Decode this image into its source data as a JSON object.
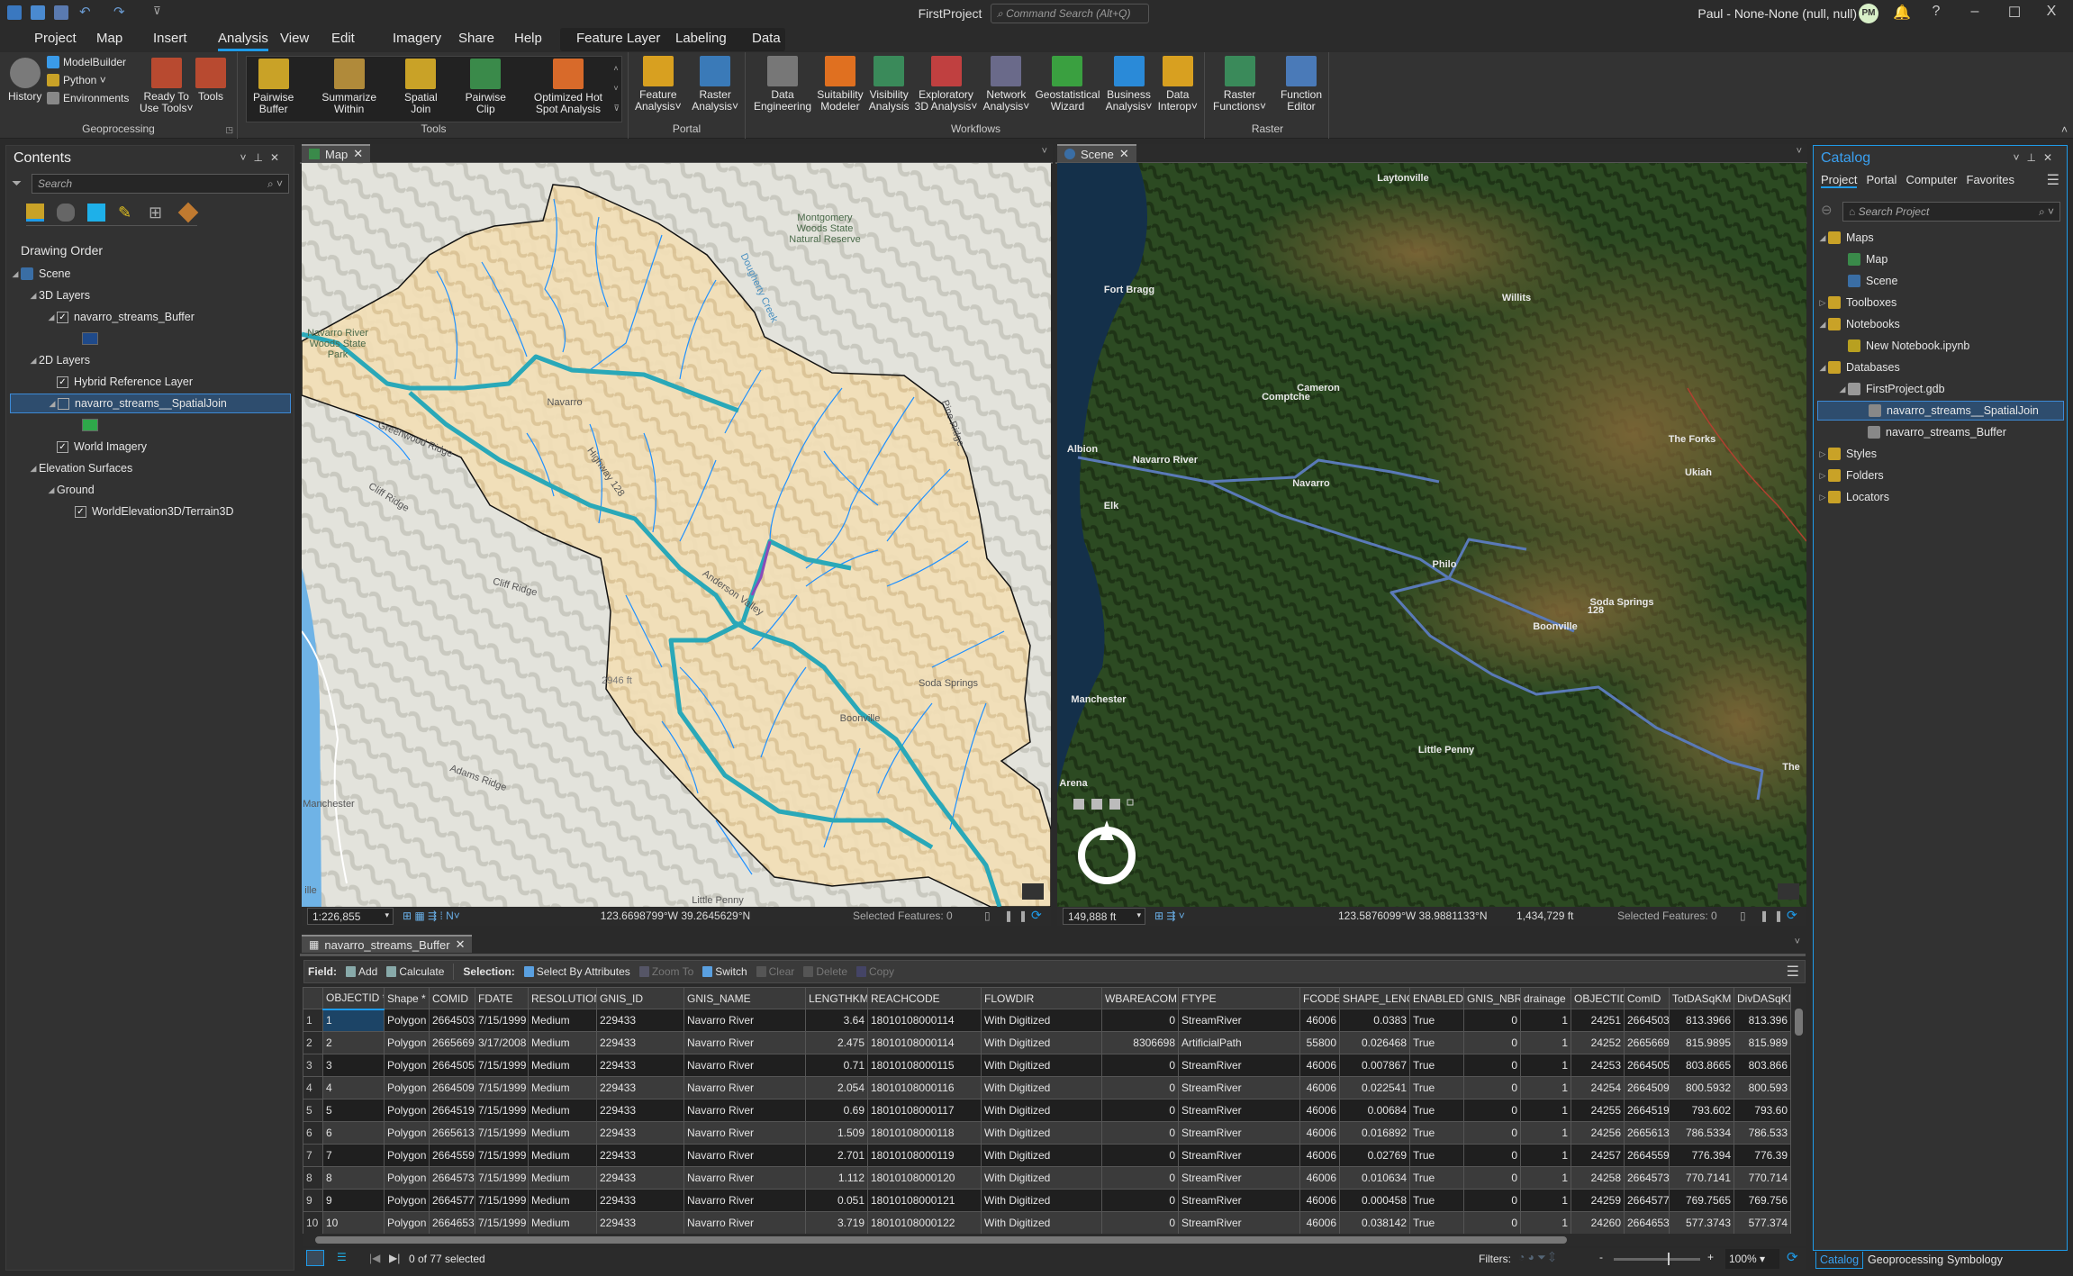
{
  "app": {
    "title": "FirstProject",
    "command_search_placeholder": "Command Search (Alt+Q)",
    "user": "Paul - None-None (null, null)",
    "avatar_initials": "PM",
    "help": "?",
    "minimize": "–",
    "maximize": "☐",
    "close": "X"
  },
  "tabs": [
    "Project",
    "Map",
    "Insert",
    "Analysis",
    "View",
    "Edit",
    "Imagery",
    "Share",
    "Help"
  ],
  "active_tab": "Analysis",
  "contextual_tabs": [
    "Feature Layer",
    "Labeling",
    "Data"
  ],
  "ribbon": {
    "geoprocessing": {
      "label": "Geoprocessing",
      "history": "History",
      "small": [
        "ModelBuilder",
        "Python ˅",
        "Environments"
      ],
      "ready": "Ready To\nUse Tools˅",
      "tools": "Tools"
    },
    "tools": {
      "label": "Tools",
      "buttons": [
        {
          "label": "Pairwise\nBuffer",
          "icon": "pairwise-buffer-icon",
          "color": "#c9a227"
        },
        {
          "label": "Summarize\nWithin",
          "icon": "summarize-within-icon",
          "color": "#b08a3a"
        },
        {
          "label": "Spatial\nJoin",
          "icon": "spatial-join-icon",
          "color": "#c9a227"
        },
        {
          "label": "Pairwise\nClip",
          "icon": "pairwise-clip-icon",
          "color": "#3a8a4a"
        },
        {
          "label": "Optimized Hot\nSpot Analysis",
          "icon": "hot-spot-icon",
          "color": "#d86a2a"
        }
      ]
    },
    "portal": {
      "label": "Portal",
      "buttons": [
        {
          "label": "Feature\nAnalysis˅",
          "icon": "feature-analysis-icon",
          "color": "#d8a020"
        },
        {
          "label": "Raster\nAnalysis˅",
          "icon": "raster-analysis-icon",
          "color": "#3a7ab8"
        }
      ]
    },
    "workflows": {
      "label": "Workflows",
      "buttons": [
        {
          "label": "Data\nEngineering",
          "icon": "data-engineering-icon",
          "color": "#777777"
        },
        {
          "label": "Suitability\nModeler",
          "icon": "suitability-modeler-icon",
          "color": "#e07020"
        },
        {
          "label": "Visibility\nAnalysis",
          "icon": "visibility-analysis-icon",
          "color": "#3a8a5a"
        },
        {
          "label": "Exploratory\n3D Analysis˅",
          "icon": "exploratory-3d-icon",
          "color": "#c04040"
        },
        {
          "label": "Network\nAnalysis˅",
          "icon": "network-analysis-icon",
          "color": "#6a6a8a"
        },
        {
          "label": "Geostatistical\nWizard",
          "icon": "geostatistical-wizard-icon",
          "color": "#3aa040"
        },
        {
          "label": "Business\nAnalysis˅",
          "icon": "business-analysis-icon",
          "color": "#2a8ad8"
        },
        {
          "label": "Data\nInterop˅",
          "icon": "data-interop-icon",
          "color": "#d8a020"
        }
      ]
    },
    "raster": {
      "label": "Raster",
      "buttons": [
        {
          "label": "Raster\nFunctions˅",
          "icon": "raster-functions-icon",
          "color": "#3a8a5a"
        },
        {
          "label": "Function\nEditor",
          "icon": "function-editor-icon",
          "color": "#4a7ab8"
        }
      ]
    }
  },
  "contents": {
    "title": "Contents",
    "search_placeholder": "Search",
    "section": "Drawing Order",
    "items": [
      {
        "label": "Scene",
        "depth": 0,
        "exp": "◢",
        "icon": "globe-icon",
        "color": "#3a6ea5"
      },
      {
        "label": "3D Layers",
        "depth": 1,
        "exp": "◢"
      },
      {
        "label": "navarro_streams_Buffer",
        "depth": 2,
        "exp": "◢",
        "check": true
      },
      {
        "swatch": "#1f4a8a",
        "depth": 2
      },
      {
        "label": "2D Layers",
        "depth": 1,
        "exp": "◢"
      },
      {
        "label": "Hybrid Reference Layer",
        "depth": 2,
        "check": true
      },
      {
        "label": "navarro_streams__SpatialJoin",
        "depth": 2,
        "exp": "◢",
        "check": false,
        "selected": true
      },
      {
        "swatch": "#2ea84a",
        "depth": 2
      },
      {
        "label": "World Imagery",
        "depth": 2,
        "check": true
      },
      {
        "label": "Elevation Surfaces",
        "depth": 1,
        "exp": "◢"
      },
      {
        "label": "Ground",
        "depth": 2,
        "exp": "◢"
      },
      {
        "label": "WorldElevation3D/Terrain3D",
        "depth": 3,
        "check": true
      }
    ]
  },
  "map_view": {
    "tab": "Map",
    "labels": [
      "Montgomery",
      "Woods State",
      "Natural Reserve",
      "Navarro River",
      "Woods State",
      "Park",
      "Navarro",
      "Cliff Ridge",
      "Cliff Ridge",
      "Adams Ridge",
      "Manchester",
      "Little Penny",
      "Soda Springs",
      "Boonville",
      "Anderson Valley",
      "Dougherty Creek",
      "Pine Ridge",
      "Greenwood Ridge",
      "Highway 128",
      "2946 ft",
      "ille"
    ],
    "scale": "1:226,855",
    "coordinates": "123.6698799°W 39.2645629°N",
    "selected_features": "Selected Features: 0"
  },
  "scene_view": {
    "tab": "Scene",
    "labels": [
      "Laytonville",
      "Fort Bragg",
      "Willits",
      "Navarro River",
      "Navarro",
      "Philo",
      "Soda Springs",
      "Boonville",
      "Manchester",
      "Little Penny",
      "The",
      "Ukiah",
      "The Forks",
      "Albion",
      "Elk",
      "Comptche",
      "Cameron",
      "Arena",
      "128"
    ],
    "scale": "149,888 ft",
    "coordinates": "123.5876099°W 38.9881133°N",
    "elevation": "1,434,729 ft",
    "selected_features": "Selected Features: 0"
  },
  "catalog": {
    "title": "Catalog",
    "tabs": [
      "Project",
      "Portal",
      "Computer",
      "Favorites"
    ],
    "active_tab": "Project",
    "search_placeholder": "Search Project",
    "items": [
      {
        "label": "Maps",
        "depth": 0,
        "exp": "◢",
        "color": "#c9a227"
      },
      {
        "label": "Map",
        "depth": 1,
        "color": "#3a8a4a"
      },
      {
        "label": "Scene",
        "depth": 1,
        "color": "#3a6ea5"
      },
      {
        "label": "Toolboxes",
        "depth": 0,
        "exp": "▷",
        "color": "#c9a227"
      },
      {
        "label": "Notebooks",
        "depth": 0,
        "exp": "◢",
        "color": "#c9a227"
      },
      {
        "label": "New Notebook.ipynb",
        "depth": 1,
        "color": "#b8a020"
      },
      {
        "label": "Databases",
        "depth": 0,
        "exp": "◢",
        "color": "#c9a227"
      },
      {
        "label": "FirstProject.gdb",
        "depth": 1,
        "exp": "◢",
        "color": "#999999"
      },
      {
        "label": "navarro_streams__SpatialJoin",
        "depth": 2,
        "color": "#888888",
        "selected": true
      },
      {
        "label": "navarro_streams_Buffer",
        "depth": 2,
        "color": "#888888"
      },
      {
        "label": "Styles",
        "depth": 0,
        "exp": "▷",
        "color": "#c9a227"
      },
      {
        "label": "Folders",
        "depth": 0,
        "exp": "▷",
        "color": "#c9a227"
      },
      {
        "label": "Locators",
        "depth": 0,
        "exp": "▷",
        "color": "#c9a227"
      }
    ],
    "bottom_tabs": [
      "Catalog",
      "Geoprocessing",
      "Symbology"
    ]
  },
  "table": {
    "tab": "navarro_streams_Buffer",
    "toolbar": {
      "field": "Field:",
      "add": "Add",
      "calculate": "Calculate",
      "selection": "Selection:",
      "select_by_attributes": "Select By Attributes",
      "zoom_to": "Zoom To",
      "switch": "Switch",
      "clear": "Clear",
      "delete": "Delete",
      "copy": "Copy"
    },
    "columns": [
      "",
      "OBJECTID *",
      "Shape *",
      "COMID",
      "FDATE",
      "RESOLUTION",
      "GNIS_ID",
      "GNIS_NAME",
      "LENGTHKM",
      "REACHCODE",
      "FLOWDIR",
      "WBAREACOMI",
      "FTYPE",
      "FCODE",
      "SHAPE_LENG",
      "ENABLED",
      "GNIS_NBR",
      "drainage",
      "OBJECTID",
      "ComID",
      "TotDASqKM",
      "DivDASqKM"
    ],
    "rows": [
      [
        "1",
        "1",
        "Polygon",
        "2664503",
        "7/15/1999",
        "Medium",
        "229433",
        "Navarro River",
        "3.64",
        "18010108000114",
        "With Digitized",
        "0",
        "StreamRiver",
        "46006",
        "0.0383",
        "True",
        "0",
        "1",
        "24251",
        "2664503",
        "813.3966",
        "813.396"
      ],
      [
        "2",
        "2",
        "Polygon",
        "2665669",
        "3/17/2008",
        "Medium",
        "229433",
        "Navarro River",
        "2.475",
        "18010108000114",
        "With Digitized",
        "8306698",
        "ArtificialPath",
        "55800",
        "0.026468",
        "True",
        "0",
        "1",
        "24252",
        "2665669",
        "815.9895",
        "815.989"
      ],
      [
        "3",
        "3",
        "Polygon",
        "2664505",
        "7/15/1999",
        "Medium",
        "229433",
        "Navarro River",
        "0.71",
        "18010108000115",
        "With Digitized",
        "0",
        "StreamRiver",
        "46006",
        "0.007867",
        "True",
        "0",
        "1",
        "24253",
        "2664505",
        "803.8665",
        "803.866"
      ],
      [
        "4",
        "4",
        "Polygon",
        "2664509",
        "7/15/1999",
        "Medium",
        "229433",
        "Navarro River",
        "2.054",
        "18010108000116",
        "With Digitized",
        "0",
        "StreamRiver",
        "46006",
        "0.022541",
        "True",
        "0",
        "1",
        "24254",
        "2664509",
        "800.5932",
        "800.593"
      ],
      [
        "5",
        "5",
        "Polygon",
        "2664519",
        "7/15/1999",
        "Medium",
        "229433",
        "Navarro River",
        "0.69",
        "18010108000117",
        "With Digitized",
        "0",
        "StreamRiver",
        "46006",
        "0.00684",
        "True",
        "0",
        "1",
        "24255",
        "2664519",
        "793.602",
        "793.60"
      ],
      [
        "6",
        "6",
        "Polygon",
        "2665613",
        "7/15/1999",
        "Medium",
        "229433",
        "Navarro River",
        "1.509",
        "18010108000118",
        "With Digitized",
        "0",
        "StreamRiver",
        "46006",
        "0.016892",
        "True",
        "0",
        "1",
        "24256",
        "2665613",
        "786.5334",
        "786.533"
      ],
      [
        "7",
        "7",
        "Polygon",
        "2664559",
        "7/15/1999",
        "Medium",
        "229433",
        "Navarro River",
        "2.701",
        "18010108000119",
        "With Digitized",
        "0",
        "StreamRiver",
        "46006",
        "0.02769",
        "True",
        "0",
        "1",
        "24257",
        "2664559",
        "776.394",
        "776.39"
      ],
      [
        "8",
        "8",
        "Polygon",
        "2664573",
        "7/15/1999",
        "Medium",
        "229433",
        "Navarro River",
        "1.112",
        "18010108000120",
        "With Digitized",
        "0",
        "StreamRiver",
        "46006",
        "0.010634",
        "True",
        "0",
        "1",
        "24258",
        "2664573",
        "770.7141",
        "770.714"
      ],
      [
        "9",
        "9",
        "Polygon",
        "2664577",
        "7/15/1999",
        "Medium",
        "229433",
        "Navarro River",
        "0.051",
        "18010108000121",
        "With Digitized",
        "0",
        "StreamRiver",
        "46006",
        "0.000458",
        "True",
        "0",
        "1",
        "24259",
        "2664577",
        "769.7565",
        "769.756"
      ],
      [
        "10",
        "10",
        "Polygon",
        "2664653",
        "7/15/1999",
        "Medium",
        "229433",
        "Navarro River",
        "3.719",
        "18010108000122",
        "With Digitized",
        "0",
        "StreamRiver",
        "46006",
        "0.038142",
        "True",
        "0",
        "1",
        "24260",
        "2664653",
        "577.3743",
        "577.374"
      ]
    ],
    "selection_status": "0 of 77 selected",
    "filters_label": "Filters:",
    "zoom": "100%"
  },
  "colors": {
    "accent": "#1e9be9",
    "selection": "#2e4d6e",
    "basin": "#f3dfb8",
    "stream": "#1e90ff",
    "main_stream": "#2aa8b8"
  }
}
